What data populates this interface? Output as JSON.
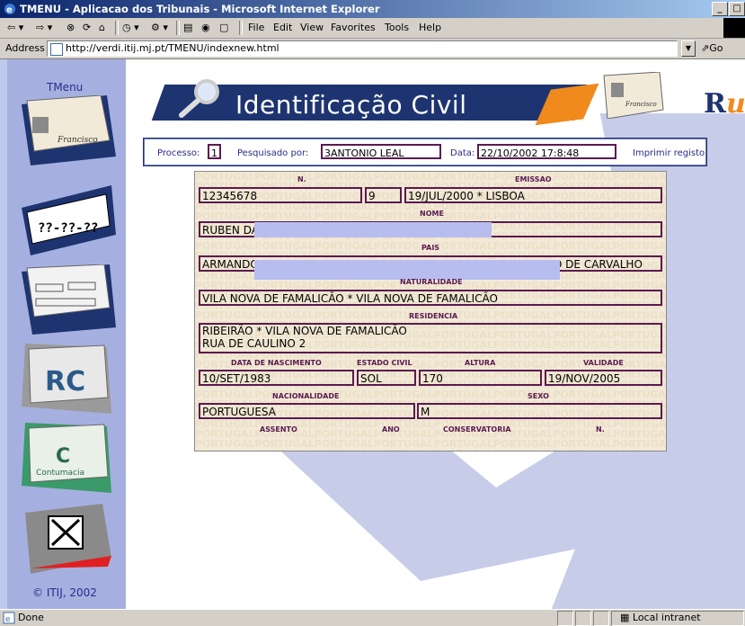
{
  "window": {
    "title": "TMENU - Aplicacao dos Tribunais - Microsoft Internet Explorer"
  },
  "menu": [
    "File",
    "Edit",
    "View",
    "Favorites",
    "Tools",
    "Help"
  ],
  "address": {
    "label": "Address",
    "url": "http://verdi.itij.mj.pt/TMENU/indexnew.html",
    "go": "Go"
  },
  "sidebar": {
    "title": "TMenu",
    "copyright": "© ITIJ, 2002",
    "plate": "??-??-??",
    "rc": "RC",
    "contumacia": "Contumacia"
  },
  "banner": {
    "title": "Identificação Civil"
  },
  "process": {
    "processo_label": "Processo:",
    "processo_value": "1",
    "pesquisado_label": "Pesquisado por:",
    "pesquisado_value": "3ANTONIO LEAL",
    "data_label": "Data:",
    "data_value": "22/10/2002 17:8:48",
    "print_link": "Imprimir registo"
  },
  "card": {
    "watermark": "PORTUGAL",
    "labels": {
      "n": "N.",
      "emissao": "EMISSAO",
      "nome": "NOME",
      "pais": "PAIS",
      "naturalidade": "NATURALIDADE",
      "residencia": "RESIDENCIA",
      "nascimento": "DATA DE NASCIMENTO",
      "estado_civil": "ESTADO CIVIL",
      "altura": "ALTURA",
      "validade": "VALIDADE",
      "nacionalidade": "NACIONALIDADE",
      "sexo": "SEXO",
      "assento": "ASSENTO",
      "ano": "ANO",
      "conservatoria": "CONSERVATORIA",
      "n2": "N."
    },
    "values": {
      "numero": "12345678",
      "digito": "9",
      "emissao": "19/JUL/2000 * LISBOA",
      "nome": "RUBEN DA",
      "pais": "ARMANDO PINTO DE CARVALHO * ALICE MARIA GONÇALVES PINTO DE CARVALHO",
      "naturalidade": "VILA NOVA DE FAMALICÃO * VILA NOVA DE FAMALICÃO",
      "residencia_1": "RIBEIRÃO * VILA NOVA DE FAMALICÃO",
      "residencia_2": "RUA DE CAULINO 2",
      "nascimento": "10/SET/1983",
      "estado_civil": "SOL",
      "altura": "170",
      "validade": "19/NOV/2005",
      "nacionalidade": "PORTUGUESA",
      "sexo": "M"
    }
  },
  "status": {
    "text": "Done",
    "zone": "Local intranet"
  }
}
